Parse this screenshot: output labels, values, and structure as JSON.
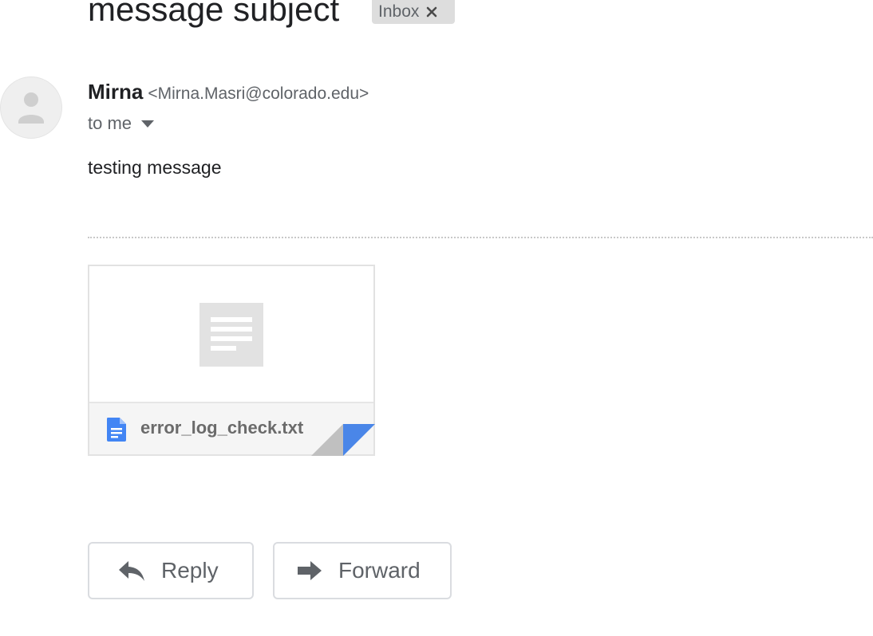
{
  "message": {
    "subject": "message subject",
    "label": "Inbox",
    "sender_name": "Mirna",
    "sender_email": "<Mirna.Masri@colorado.edu>",
    "recipient_line": "to me",
    "body": "testing message"
  },
  "attachment": {
    "file_name": "error_log_check.txt",
    "icon": "text-document-icon",
    "accent_color": "#4a86e8"
  },
  "actions": {
    "reply_label": "Reply",
    "forward_label": "Forward"
  },
  "icons": {
    "label_remove": "close-icon",
    "avatar": "default-person-icon",
    "recipient_menu": "chevron-down-icon",
    "reply": "reply-arrow-icon",
    "forward": "forward-arrow-icon"
  }
}
